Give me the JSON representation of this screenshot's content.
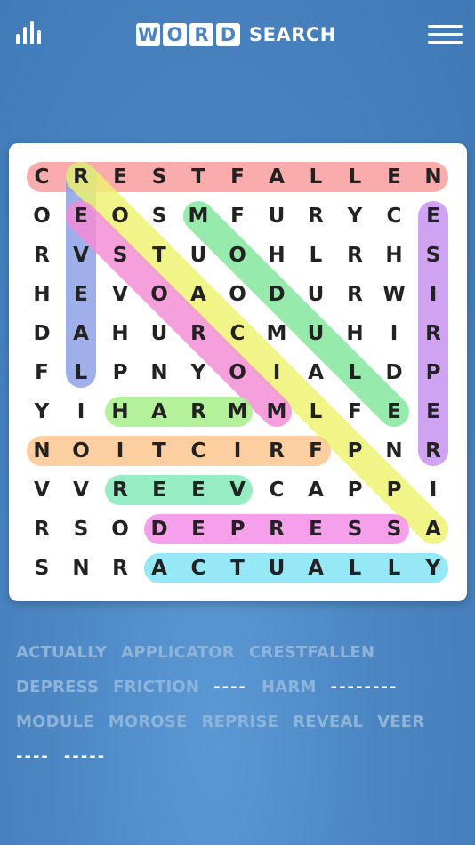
{
  "header": {
    "logo_letters": [
      "W",
      "O",
      "R",
      "D"
    ],
    "logo_word": "SEARCH",
    "stats_icon": "bar-chart-icon",
    "menu_icon": "hamburger-menu-icon"
  },
  "grid": {
    "rows": [
      [
        "C",
        "R",
        "E",
        "S",
        "T",
        "F",
        "A",
        "L",
        "L",
        "E",
        "N"
      ],
      [
        "O",
        "E",
        "O",
        "S",
        "M",
        "F",
        "U",
        "R",
        "Y",
        "C",
        "E"
      ],
      [
        "R",
        "V",
        "S",
        "T",
        "U",
        "O",
        "H",
        "L",
        "R",
        "H",
        "S"
      ],
      [
        "H",
        "E",
        "V",
        "O",
        "A",
        "O",
        "D",
        "U",
        "R",
        "W",
        "I"
      ],
      [
        "D",
        "A",
        "H",
        "U",
        "R",
        "C",
        "M",
        "U",
        "H",
        "I",
        "R"
      ],
      [
        "F",
        "L",
        "P",
        "N",
        "Y",
        "O",
        "I",
        "A",
        "L",
        "D",
        "P"
      ],
      [
        "Y",
        "I",
        "H",
        "A",
        "R",
        "M",
        "M",
        "L",
        "F",
        "E",
        "E"
      ],
      [
        "N",
        "O",
        "I",
        "T",
        "C",
        "I",
        "R",
        "F",
        "P",
        "N",
        "R"
      ],
      [
        "V",
        "V",
        "R",
        "E",
        "E",
        "V",
        "C",
        "A",
        "P",
        "P",
        "I"
      ],
      [
        "R",
        "S",
        "O",
        "D",
        "E",
        "P",
        "R",
        "E",
        "S",
        "S",
        "A"
      ],
      [
        "S",
        "N",
        "R",
        "A",
        "C",
        "T",
        "U",
        "A",
        "L",
        "L",
        "Y"
      ]
    ]
  },
  "highlights": [
    {
      "word": "CRESTFALLEN",
      "from": [
        0,
        0
      ],
      "to": [
        0,
        10
      ],
      "color": "#f99a9a"
    },
    {
      "word": "REVEAL",
      "from": [
        0,
        1
      ],
      "to": [
        5,
        1
      ],
      "color": "#8a9ee6"
    },
    {
      "word": "APPLICATOR",
      "from": [
        9,
        10
      ],
      "to": [
        0,
        1
      ],
      "color": "#eef36e"
    },
    {
      "word": "MOROSE",
      "from": [
        6,
        6
      ],
      "to": [
        1,
        1
      ],
      "color": "#f58ad6"
    },
    {
      "word": "MODULE",
      "from": [
        1,
        4
      ],
      "to": [
        6,
        9
      ],
      "color": "#7fe79b"
    },
    {
      "word": "REPRISE",
      "from": [
        7,
        10
      ],
      "to": [
        1,
        10
      ],
      "color": "#c58ff0"
    },
    {
      "word": "HARM",
      "from": [
        6,
        2
      ],
      "to": [
        6,
        5
      ],
      "color": "#a4ef86"
    },
    {
      "word": "FRICTION",
      "from": [
        7,
        7
      ],
      "to": [
        7,
        0
      ],
      "color": "#fcc48c"
    },
    {
      "word": "VEER",
      "from": [
        8,
        5
      ],
      "to": [
        8,
        2
      ],
      "color": "#7fe8b6"
    },
    {
      "word": "DEPRESS",
      "from": [
        9,
        3
      ],
      "to": [
        9,
        9
      ],
      "color": "#f58ce8"
    },
    {
      "word": "ACTUALLY",
      "from": [
        10,
        3
      ],
      "to": [
        10,
        10
      ],
      "color": "#7fe3f5"
    }
  ],
  "wordlist": {
    "rows": [
      [
        {
          "text": "ACTUALLY",
          "hidden": false
        },
        {
          "text": "APPLICATOR",
          "hidden": false
        },
        {
          "text": "CRESTFALLEN",
          "hidden": false
        }
      ],
      [
        {
          "text": "DEPRESS",
          "hidden": false
        },
        {
          "text": "FRICTION",
          "hidden": false
        },
        {
          "text": "----",
          "hidden": true
        },
        {
          "text": "HARM",
          "hidden": false
        },
        {
          "text": "--------",
          "hidden": true
        }
      ],
      [
        {
          "text": "MODULE",
          "hidden": false
        },
        {
          "text": "MOROSE",
          "hidden": false
        },
        {
          "text": "REPRISE",
          "hidden": false
        },
        {
          "text": "REVEAL",
          "hidden": false
        },
        {
          "text": "VEER",
          "hidden": false
        }
      ],
      [
        {
          "text": "----",
          "hidden": true
        },
        {
          "text": "-----",
          "hidden": true
        }
      ]
    ]
  }
}
